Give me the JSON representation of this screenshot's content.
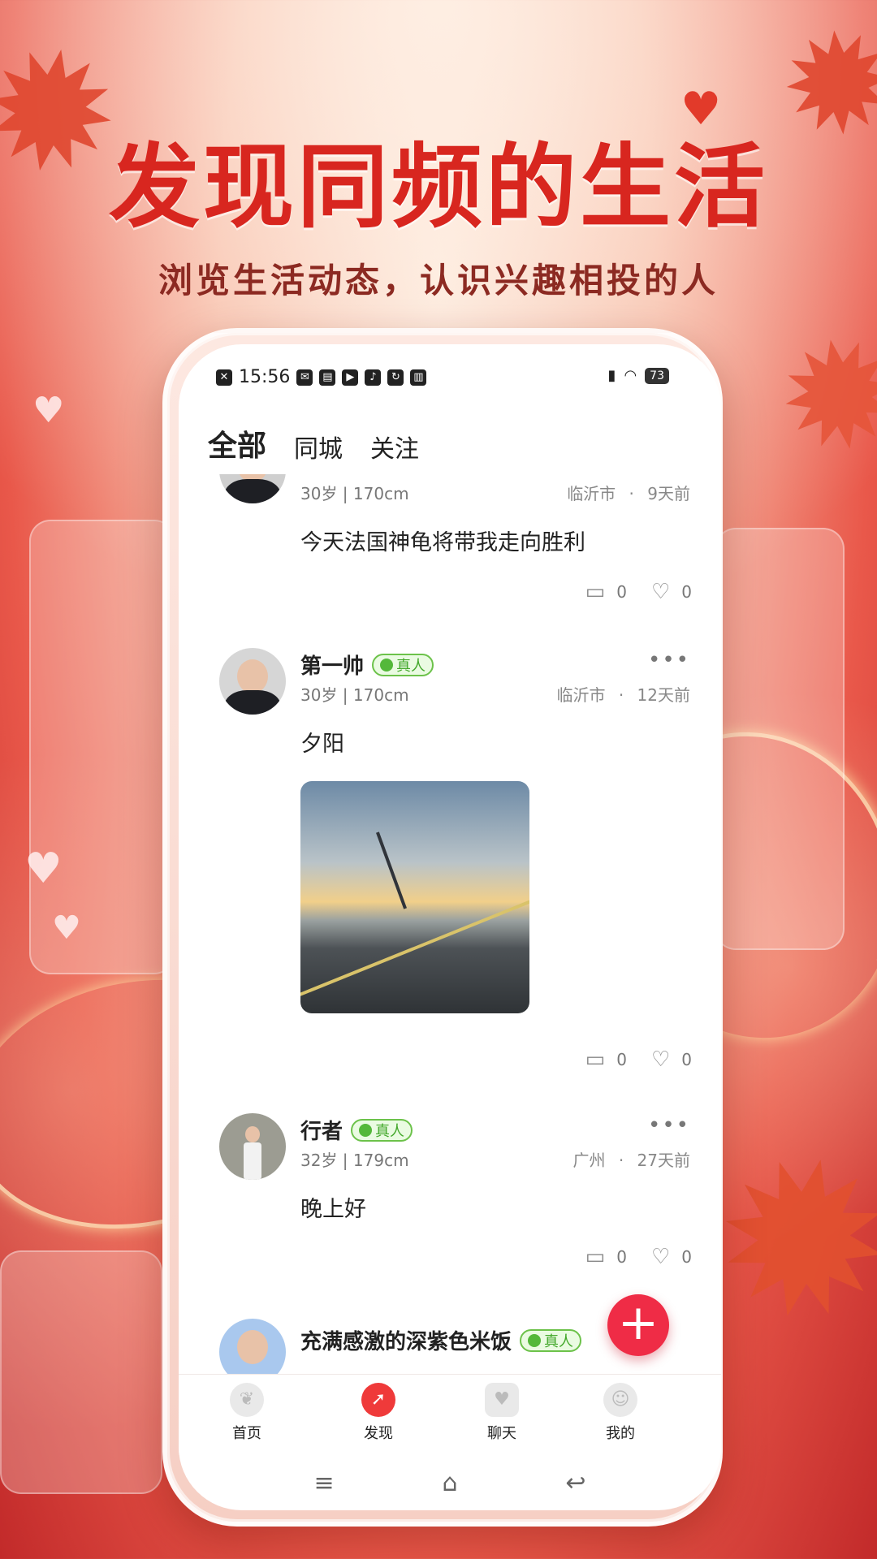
{
  "promo": {
    "headline": "发现同频的生活",
    "subline": "浏览生活动态，认识兴趣相投的人"
  },
  "status_bar": {
    "time": "15:56",
    "battery": "73"
  },
  "tabs": [
    {
      "label": "全部",
      "active": true
    },
    {
      "label": "同城",
      "active": false
    },
    {
      "label": "关注",
      "active": false
    }
  ],
  "posts": [
    {
      "meta": "30岁 | 170cm",
      "location": "临沂市",
      "time_ago": "9天前",
      "text": "今天法国神龟将带我走向胜利",
      "comments": "0",
      "likes": "0"
    },
    {
      "name": "第一帅",
      "badge": "真人",
      "meta": "30岁 | 170cm",
      "location": "临沂市",
      "time_ago": "12天前",
      "text": "夕阳",
      "has_photo": true,
      "comments": "0",
      "likes": "0"
    },
    {
      "name": "行者",
      "badge": "真人",
      "meta": "32岁 | 179cm",
      "location": "广州",
      "time_ago": "27天前",
      "text": "晚上好",
      "comments": "0",
      "likes": "0"
    },
    {
      "name": "充满感激的深紫色米饭",
      "badge": "真人"
    }
  ],
  "separator": "·",
  "more_label": "•••",
  "fab": {
    "icon": "plus-icon",
    "label": "+"
  },
  "bottom_nav": [
    {
      "label": "首页",
      "icon": "home-leaf-icon"
    },
    {
      "label": "发现",
      "icon": "compass-icon",
      "active": true
    },
    {
      "label": "聊天",
      "icon": "chat-icon"
    },
    {
      "label": "我的",
      "icon": "profile-icon"
    }
  ],
  "colors": {
    "accent": "#ef2c46",
    "badge_green": "#54b83a",
    "headline_red": "#d8261f"
  }
}
